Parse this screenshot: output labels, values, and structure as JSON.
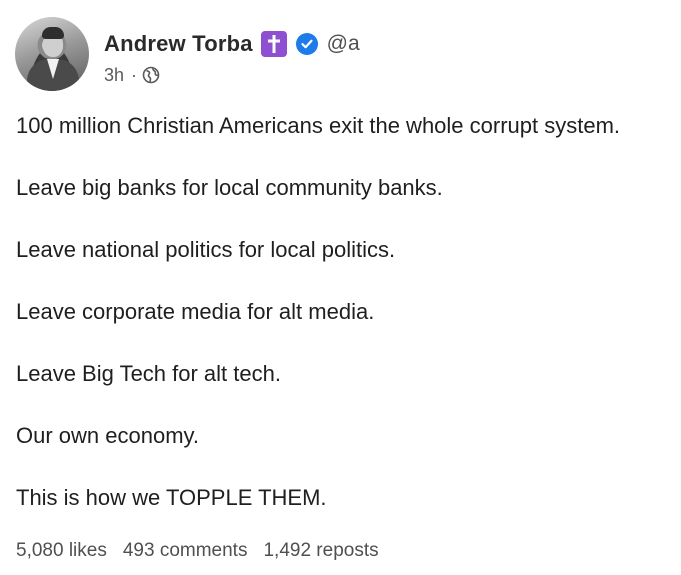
{
  "author": {
    "name": "Andrew Torba",
    "handle": "@a",
    "badge_icon": "cross-icon",
    "verified_icon": "verified-check-icon"
  },
  "meta": {
    "time": "3h",
    "separator": "·",
    "visibility_icon": "globe-icon"
  },
  "post": {
    "lines": [
      "100 million Christian Americans exit the whole corrupt system.",
      "Leave big banks for local community banks.",
      "Leave national politics for local politics.",
      "Leave corporate media for alt media.",
      "Leave Big Tech for alt tech.",
      "Our own economy.",
      "This is how we TOPPLE THEM."
    ]
  },
  "stats": {
    "likes": "5,080 likes",
    "comments": "493 comments",
    "reposts": "1,492 reposts"
  },
  "colors": {
    "badge_purple": "#8e4fd1",
    "verified_blue": "#1d7bea",
    "text": "#1f1f1f",
    "muted": "#505050"
  }
}
